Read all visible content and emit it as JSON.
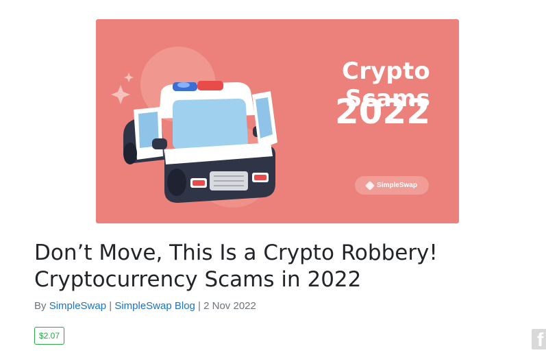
{
  "hero": {
    "title": "Crypto Scams",
    "year": "2022",
    "badge_label": "SimpleSwap"
  },
  "article": {
    "title": "Don’t Move, This Is a Crypto Robbery! Cryptocurrency Scams in 2022",
    "meta_prefix": "By",
    "author": "SimpleSwap",
    "separator": "|",
    "category": "SimpleSwap Blog",
    "date": "2 Nov 2022",
    "price": "$2.07"
  },
  "share": {
    "facebook_glyph": "f",
    "facebook_icon": "facebook-icon"
  },
  "colors": {
    "hero_background": "#ec807a",
    "link": "#1a73c8",
    "price_green": "#28a745",
    "title_text": "#212529"
  }
}
